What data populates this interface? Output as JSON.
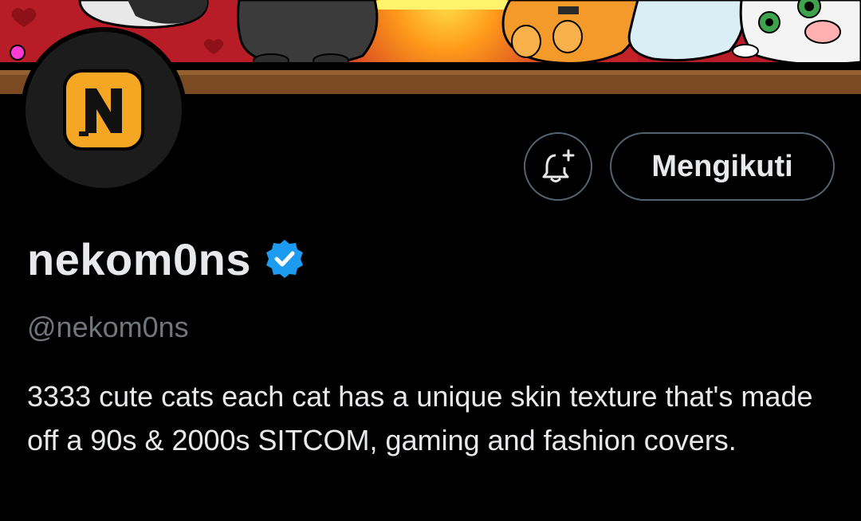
{
  "profile": {
    "display_name": "nekom0ns",
    "handle": "@nekom0ns",
    "bio": "3333 cute cats each cat has a unique skin texture that's made off a 90s & 2000s SITCOM, gaming and fashion covers.",
    "verified": true
  },
  "actions": {
    "notify_icon": "bell-plus-icon",
    "follow_label": "Mengikuti"
  },
  "avatar": {
    "logo_icon": "n-logo-icon"
  },
  "colors": {
    "background": "#000000",
    "text_primary": "#e7e9ea",
    "text_secondary": "#71767b",
    "button_border": "#536471",
    "verified_blue": "#1d9bf0",
    "logo_yellow": "#f5a623",
    "banner_red": "#c0202a",
    "shelf_brown": "#7a4a22"
  }
}
